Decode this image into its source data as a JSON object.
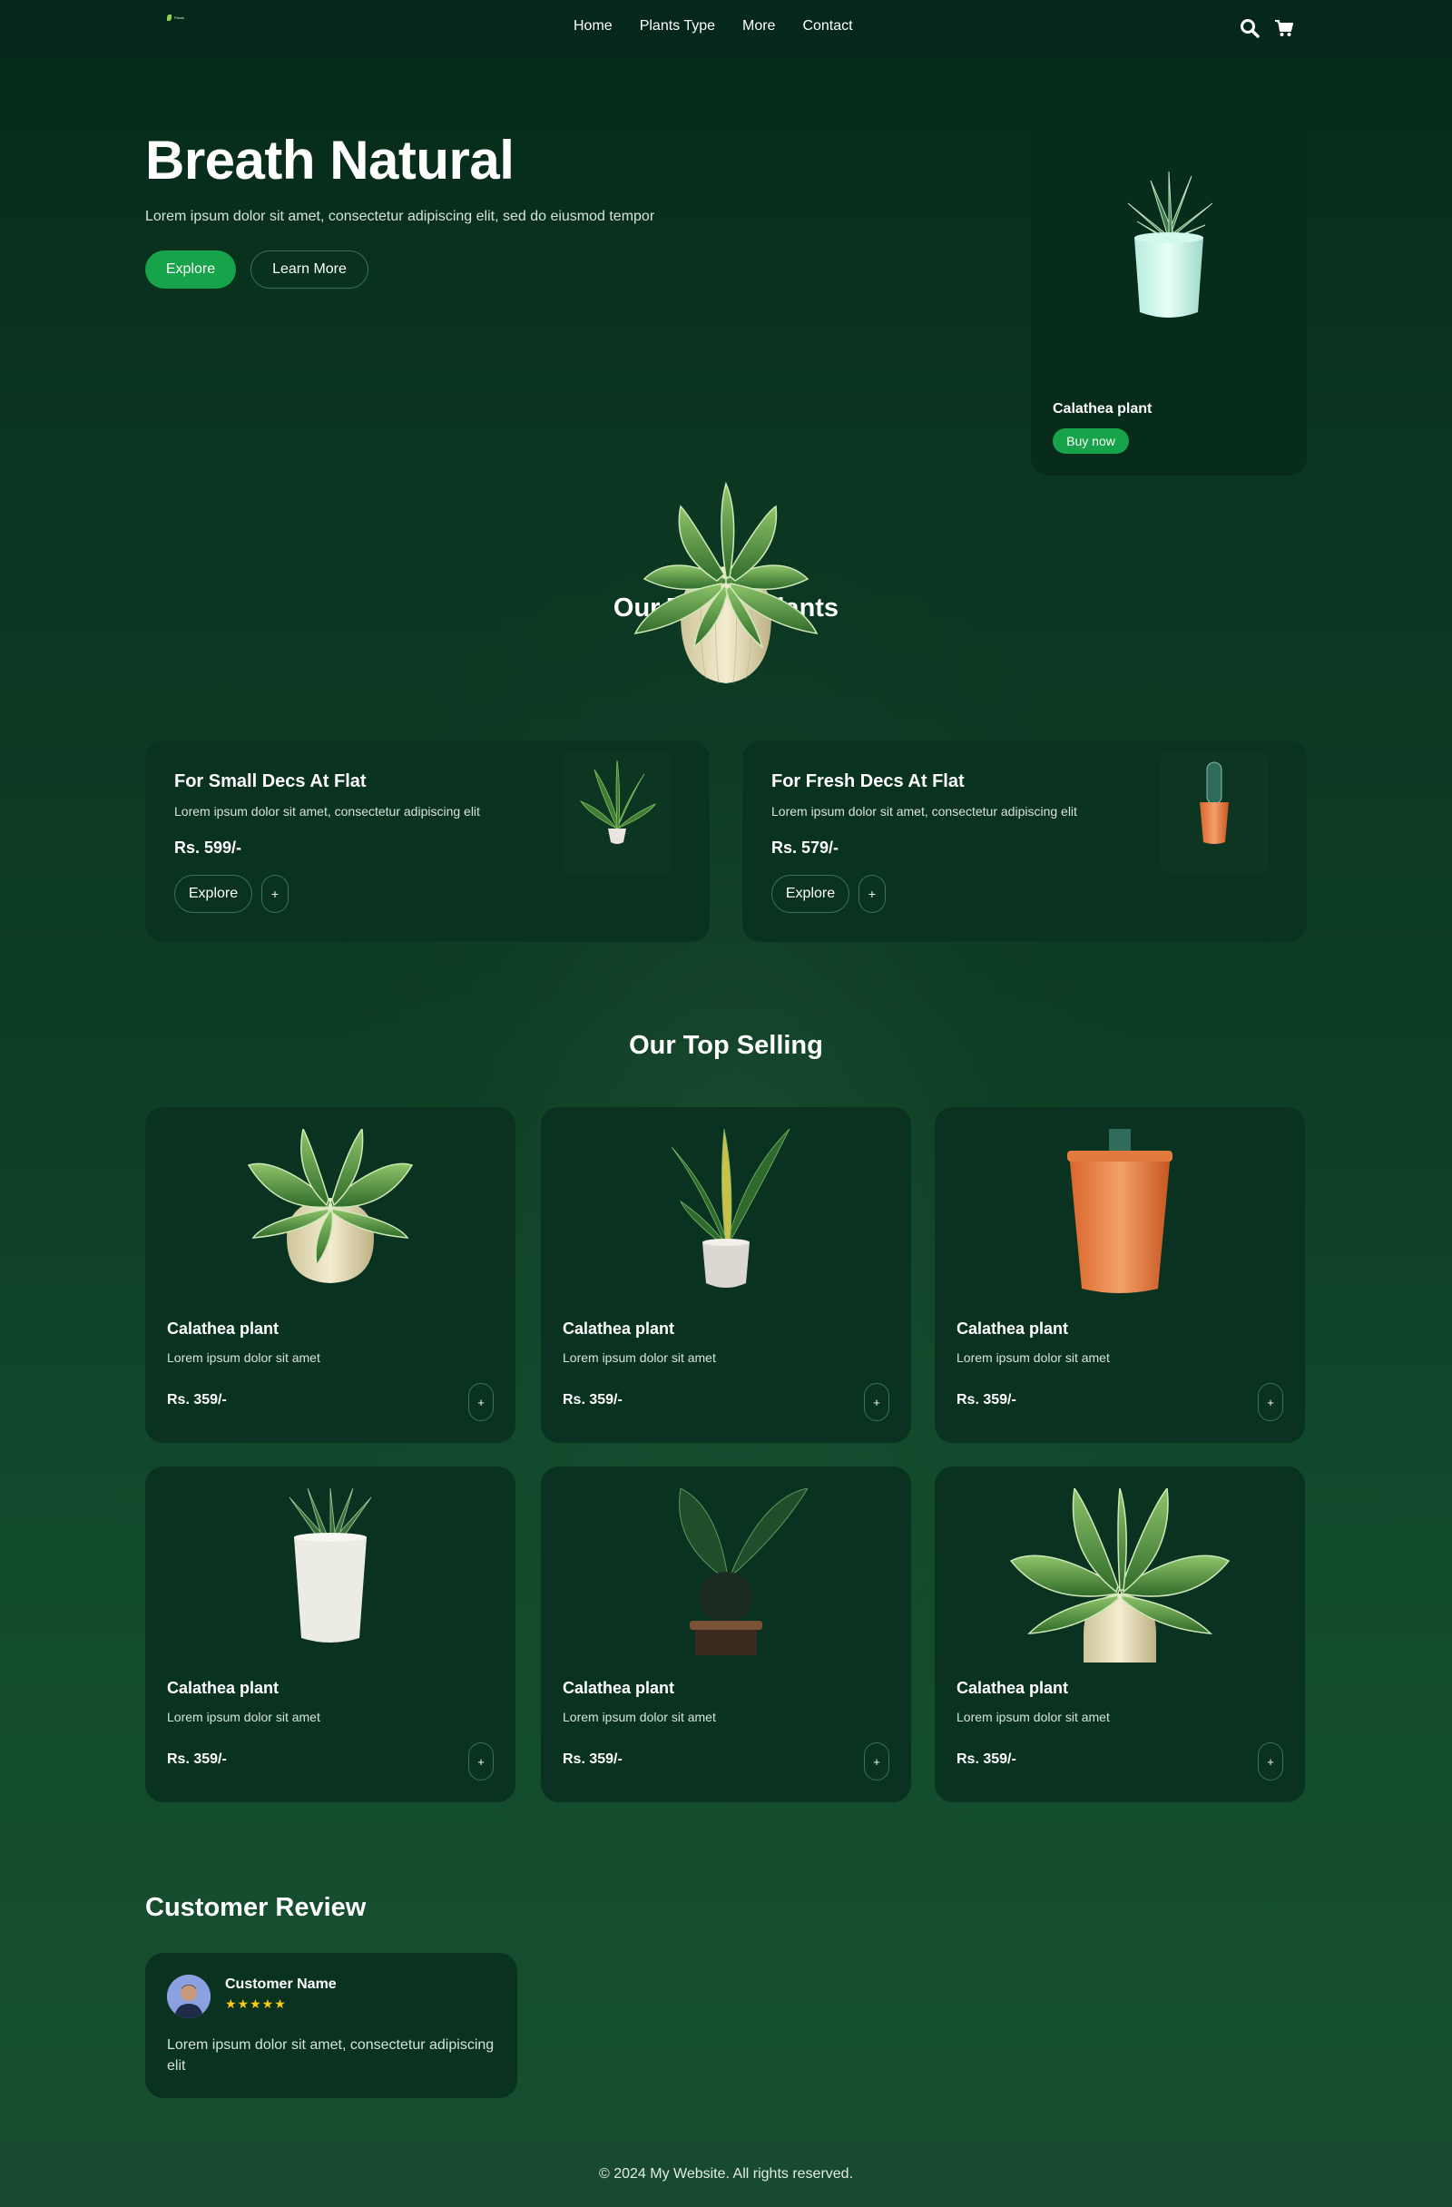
{
  "nav": {
    "logo_text": "Plants",
    "links": [
      "Home",
      "Plants Type",
      "More",
      "Contact"
    ],
    "icons": [
      "search-icon",
      "cart-icon"
    ]
  },
  "hero": {
    "title": "Breath Natural",
    "subtitle": "Lorem ipsum dolor sit amet, consectetur adipiscing elit, sed do eiusmod tempor",
    "explore_label": "Explore",
    "learn_label": "Learn More",
    "card": {
      "name": "Calathea plant",
      "buy_label": "Buy now"
    }
  },
  "trendy": {
    "title": "Our Trendy plants",
    "cards": [
      {
        "title": "For Small Decs At Flat",
        "desc": "Lorem ipsum dolor sit amet, consectetur adipiscing elit",
        "price": "Rs. 599/-",
        "explore_label": "Explore",
        "plus_label": "+"
      },
      {
        "title": "For Fresh Decs At Flat",
        "desc": "Lorem ipsum dolor sit amet, consectetur adipiscing elit",
        "price": "Rs. 579/-",
        "explore_label": "Explore",
        "plus_label": "+"
      }
    ]
  },
  "top_selling": {
    "title": "Our Top Selling",
    "products": [
      {
        "name": "Calathea plant",
        "desc": "Lorem ipsum dolor sit amet",
        "price": "Rs. 359/-",
        "plus_label": "+"
      },
      {
        "name": "Calathea plant",
        "desc": "Lorem ipsum dolor sit amet",
        "price": "Rs. 359/-",
        "plus_label": "+"
      },
      {
        "name": "Calathea plant",
        "desc": "Lorem ipsum dolor sit amet",
        "price": "Rs. 359/-",
        "plus_label": "+"
      },
      {
        "name": "Calathea plant",
        "desc": "Lorem ipsum dolor sit amet",
        "price": "Rs. 359/-",
        "plus_label": "+"
      },
      {
        "name": "Calathea plant",
        "desc": "Lorem ipsum dolor sit amet",
        "price": "Rs. 359/-",
        "plus_label": "+"
      },
      {
        "name": "Calathea plant",
        "desc": "Lorem ipsum dolor sit amet",
        "price": "Rs. 359/-",
        "plus_label": "+"
      }
    ]
  },
  "review": {
    "title": "Customer Review",
    "name": "Customer Name",
    "stars": "★★★★★",
    "rating": 5,
    "text": "Lorem ipsum dolor sit amet, consectetur adipiscing elit"
  },
  "footer": {
    "text": "© 2024 My Website. All rights reserved."
  },
  "colors": {
    "accent": "#16a34a",
    "card": "#0a3220",
    "nav": "#05281a",
    "star": "#facc15"
  }
}
